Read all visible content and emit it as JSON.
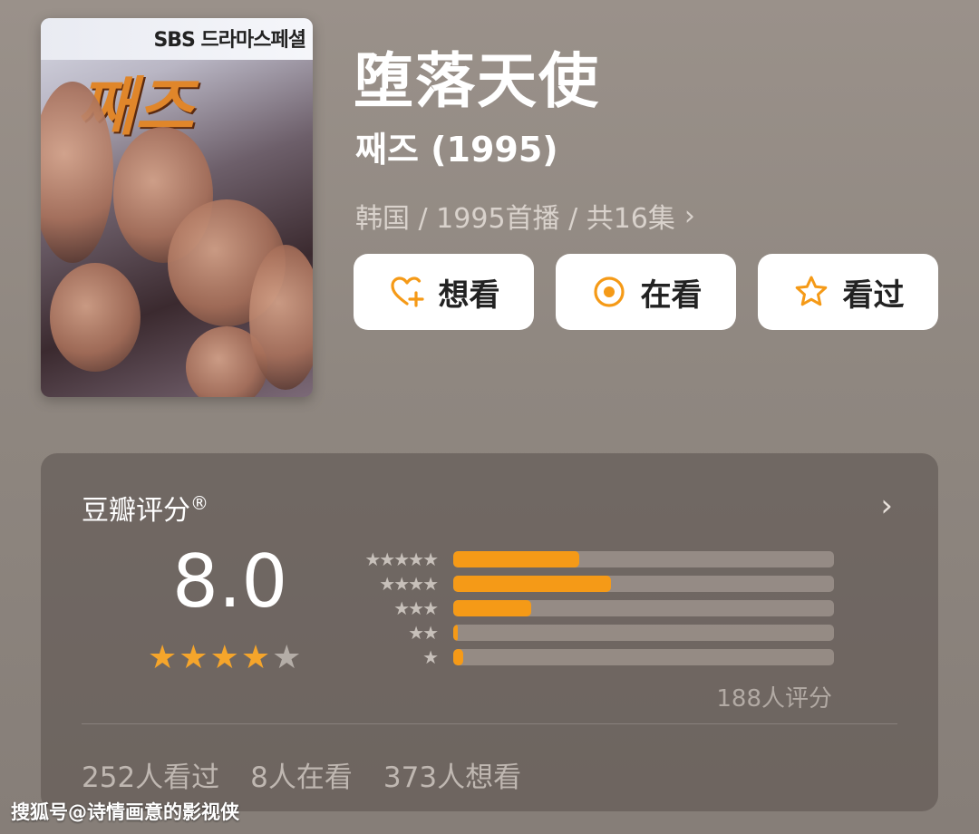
{
  "poster": {
    "channel_text": "SBS 드라마스페셜",
    "logo_text": "째즈"
  },
  "header": {
    "title": "堕落天使",
    "subtitle": "째즈 (1995)",
    "meta": "韩国 / 1995首播 / 共16集"
  },
  "actions": [
    {
      "label": "想看",
      "icon": "heart-plus-icon"
    },
    {
      "label": "在看",
      "icon": "target-circle-icon"
    },
    {
      "label": "看过",
      "icon": "star-outline-icon"
    }
  ],
  "rating": {
    "title": "豆瓣评分",
    "registered_mark": "®",
    "score": "8.0",
    "stars_filled": 4,
    "stars_total": 5,
    "distribution": [
      {
        "stars": "★★★★★",
        "fraction": 0.33
      },
      {
        "stars": "★★★★",
        "fraction": 0.415
      },
      {
        "stars": "★★★",
        "fraction": 0.205
      },
      {
        "stars": "★★",
        "fraction": 0.012
      },
      {
        "stars": "★",
        "fraction": 0.027
      }
    ],
    "raters": "188人评分",
    "counts": [
      "252人看过",
      "8人在看",
      "373人想看"
    ]
  },
  "colors": {
    "accent": "#f59a17",
    "star_on": "#f5a52b",
    "star_off": "#b4ada7"
  },
  "watermark": "搜狐号@诗情画意的影视侠"
}
